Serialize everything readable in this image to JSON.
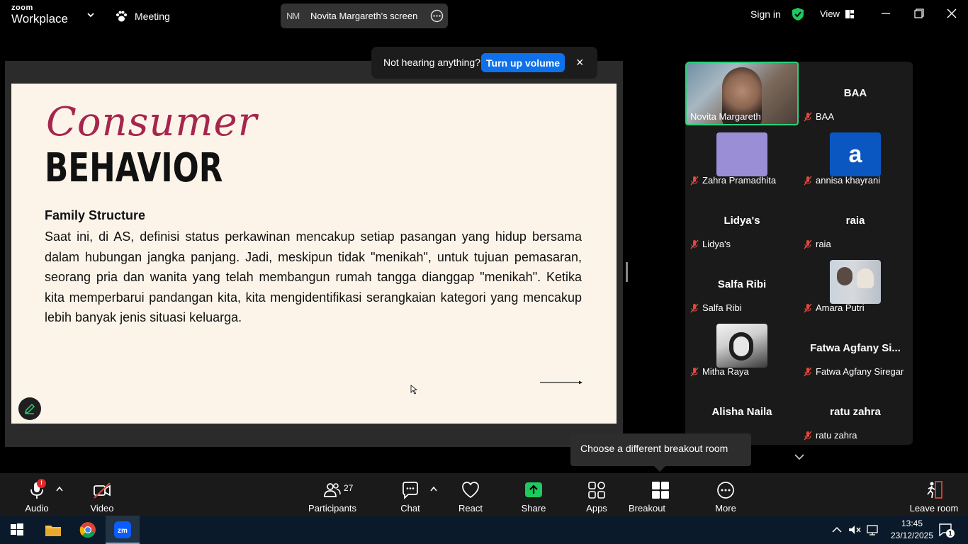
{
  "app": {
    "brand_small": "zoom",
    "brand_name": "Workplace",
    "meeting_tab": "Meeting",
    "sharer_initials": "NM",
    "screen_label": "Novita Margareth's screen",
    "sign_in": "Sign in",
    "view": "View"
  },
  "toast": {
    "text": "Not hearing anything?",
    "button": "Turn up volume",
    "close": "×"
  },
  "slide": {
    "script_title": "Consumer",
    "title": "BEHAVIOR",
    "heading": "Family Structure",
    "body": "Saat ini, di AS, definisi status perkawinan mencakup setiap pasangan yang hidup bersama dalam hubungan jangka panjang. Jadi, meskipun tidak \"menikah\", untuk tujuan pemasaran, seorang pria dan wanita yang telah membangun rumah tangga dianggap \"menikah\". Ketika kita memperbarui pandangan kita, kita mengidentifikasi serangkaian kategori yang mencakup lebih banyak jenis situasi keluarga."
  },
  "participants": [
    {
      "name": "Novita Margareth",
      "display": "",
      "kind": "video",
      "muted": false
    },
    {
      "name": "BAA",
      "display": "BAA",
      "kind": "name",
      "muted": true
    },
    {
      "name": "Zahra Pramadhita",
      "display": "",
      "kind": "avatar-purple",
      "muted": true
    },
    {
      "name": "annisa khayrani",
      "display": "a",
      "kind": "avatar-blue",
      "muted": true
    },
    {
      "name": "Lidya's",
      "display": "Lidya's",
      "kind": "name",
      "muted": true
    },
    {
      "name": "raia",
      "display": "raia",
      "kind": "name",
      "muted": true
    },
    {
      "name": "Salfa Ribi",
      "display": "Salfa Ribi",
      "kind": "name",
      "muted": true
    },
    {
      "name": "Amara Putri",
      "display": "",
      "kind": "avatar-photo",
      "muted": true
    },
    {
      "name": "Mitha Raya",
      "display": "",
      "kind": "avatar-gray",
      "muted": true
    },
    {
      "name": "Fatwa Agfany Siregar",
      "display": "Fatwa Agfany Si...",
      "kind": "name",
      "muted": true
    },
    {
      "name": "",
      "display": "Alisha Naila",
      "kind": "name",
      "muted": true
    },
    {
      "name": "ratu zahra",
      "display": "ratu zahra",
      "kind": "name",
      "muted": true
    }
  ],
  "tooltip": "Choose a different breakout room",
  "toolbar": {
    "audio": "Audio",
    "audio_badge": "!",
    "video": "Video",
    "participants": "Participants",
    "participants_count": "27",
    "chat": "Chat",
    "react": "React",
    "share": "Share",
    "apps": "Apps",
    "breakout": "Breakout rooms",
    "more": "More",
    "leave": "Leave room"
  },
  "taskbar": {
    "time": "13:45",
    "date": "23/12/2025",
    "notifications": "1"
  },
  "colors": {
    "accent_blue": "#0e71eb",
    "active_green": "#2bd07a",
    "share_green": "#1ec95e",
    "mute_red": "#e0483c",
    "slide_script": "#a5264d"
  }
}
